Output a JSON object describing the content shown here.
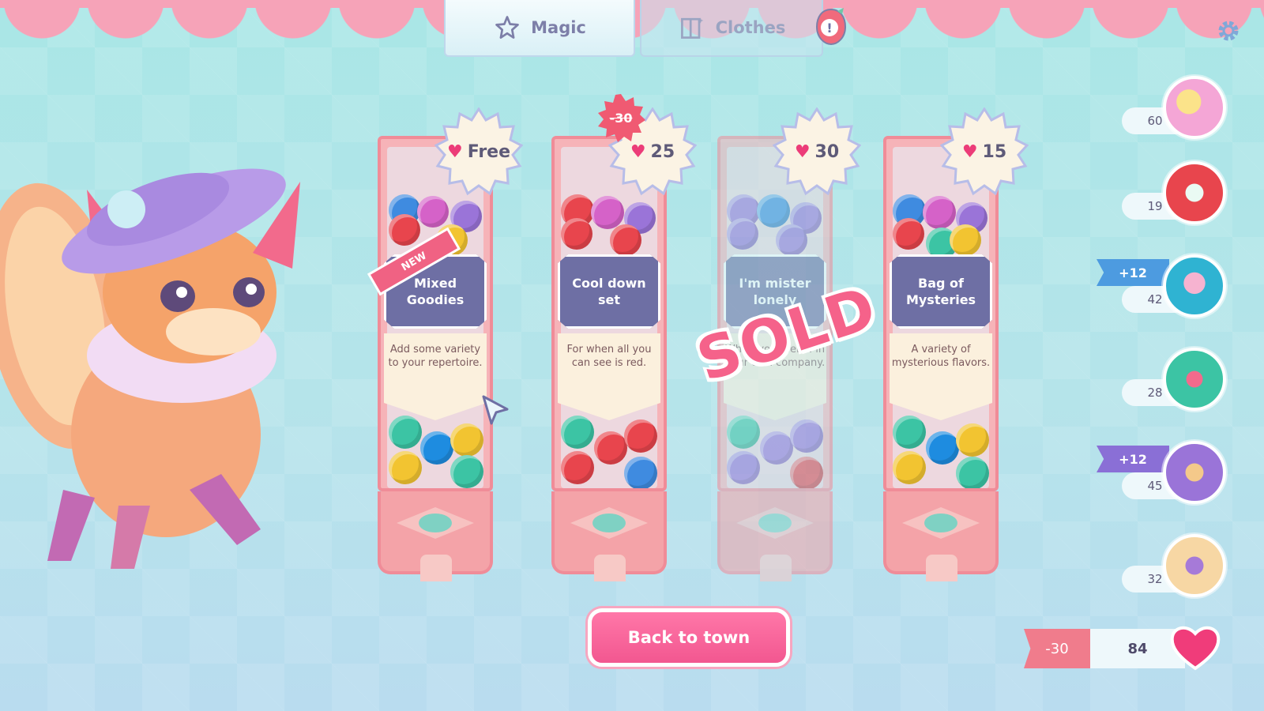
{
  "tabs": [
    {
      "label": "Magic",
      "icon": "star-icon",
      "active": true
    },
    {
      "label": "Clothes",
      "icon": "wardrobe-icon",
      "active": false
    }
  ],
  "machines": [
    {
      "name": "Mixed Goodies",
      "description": "Add some variety to your repertoire.",
      "price": "Free",
      "badge": "NEW",
      "sold": false
    },
    {
      "name": "Cool down set",
      "description": "For when all you can see is red.",
      "price": "25",
      "old_price": "-30",
      "sold": false
    },
    {
      "name": "I'm mister lonely",
      "description": "When you feel ... in your own company.",
      "price": "30",
      "sold": true
    },
    {
      "name": "Bag of Mysteries",
      "description": "A variety of mysterious flavors.",
      "price": "15",
      "sold": false
    }
  ],
  "sold_label": "SOLD",
  "back_button": "Back to town",
  "inventory": [
    {
      "count": "60",
      "color": "#f4a6d6",
      "plus": ""
    },
    {
      "count": "19",
      "color": "#e8454d",
      "plus": ""
    },
    {
      "count": "42",
      "color": "#2fb3d2",
      "plus": "+12",
      "plus_color": "#4d9be0"
    },
    {
      "count": "28",
      "color": "#3cc4a4",
      "plus": ""
    },
    {
      "count": "45",
      "color": "#9a74d8",
      "plus": "+12",
      "plus_color": "#8a6fd6"
    },
    {
      "count": "32",
      "color": "#f7d7a4",
      "plus": ""
    }
  ],
  "currency": {
    "delta": "-30",
    "total": "84"
  },
  "colors": {
    "accent_pink": "#f25790",
    "label_purple": "#6e6fa4",
    "machine_red": "#f08c98"
  }
}
